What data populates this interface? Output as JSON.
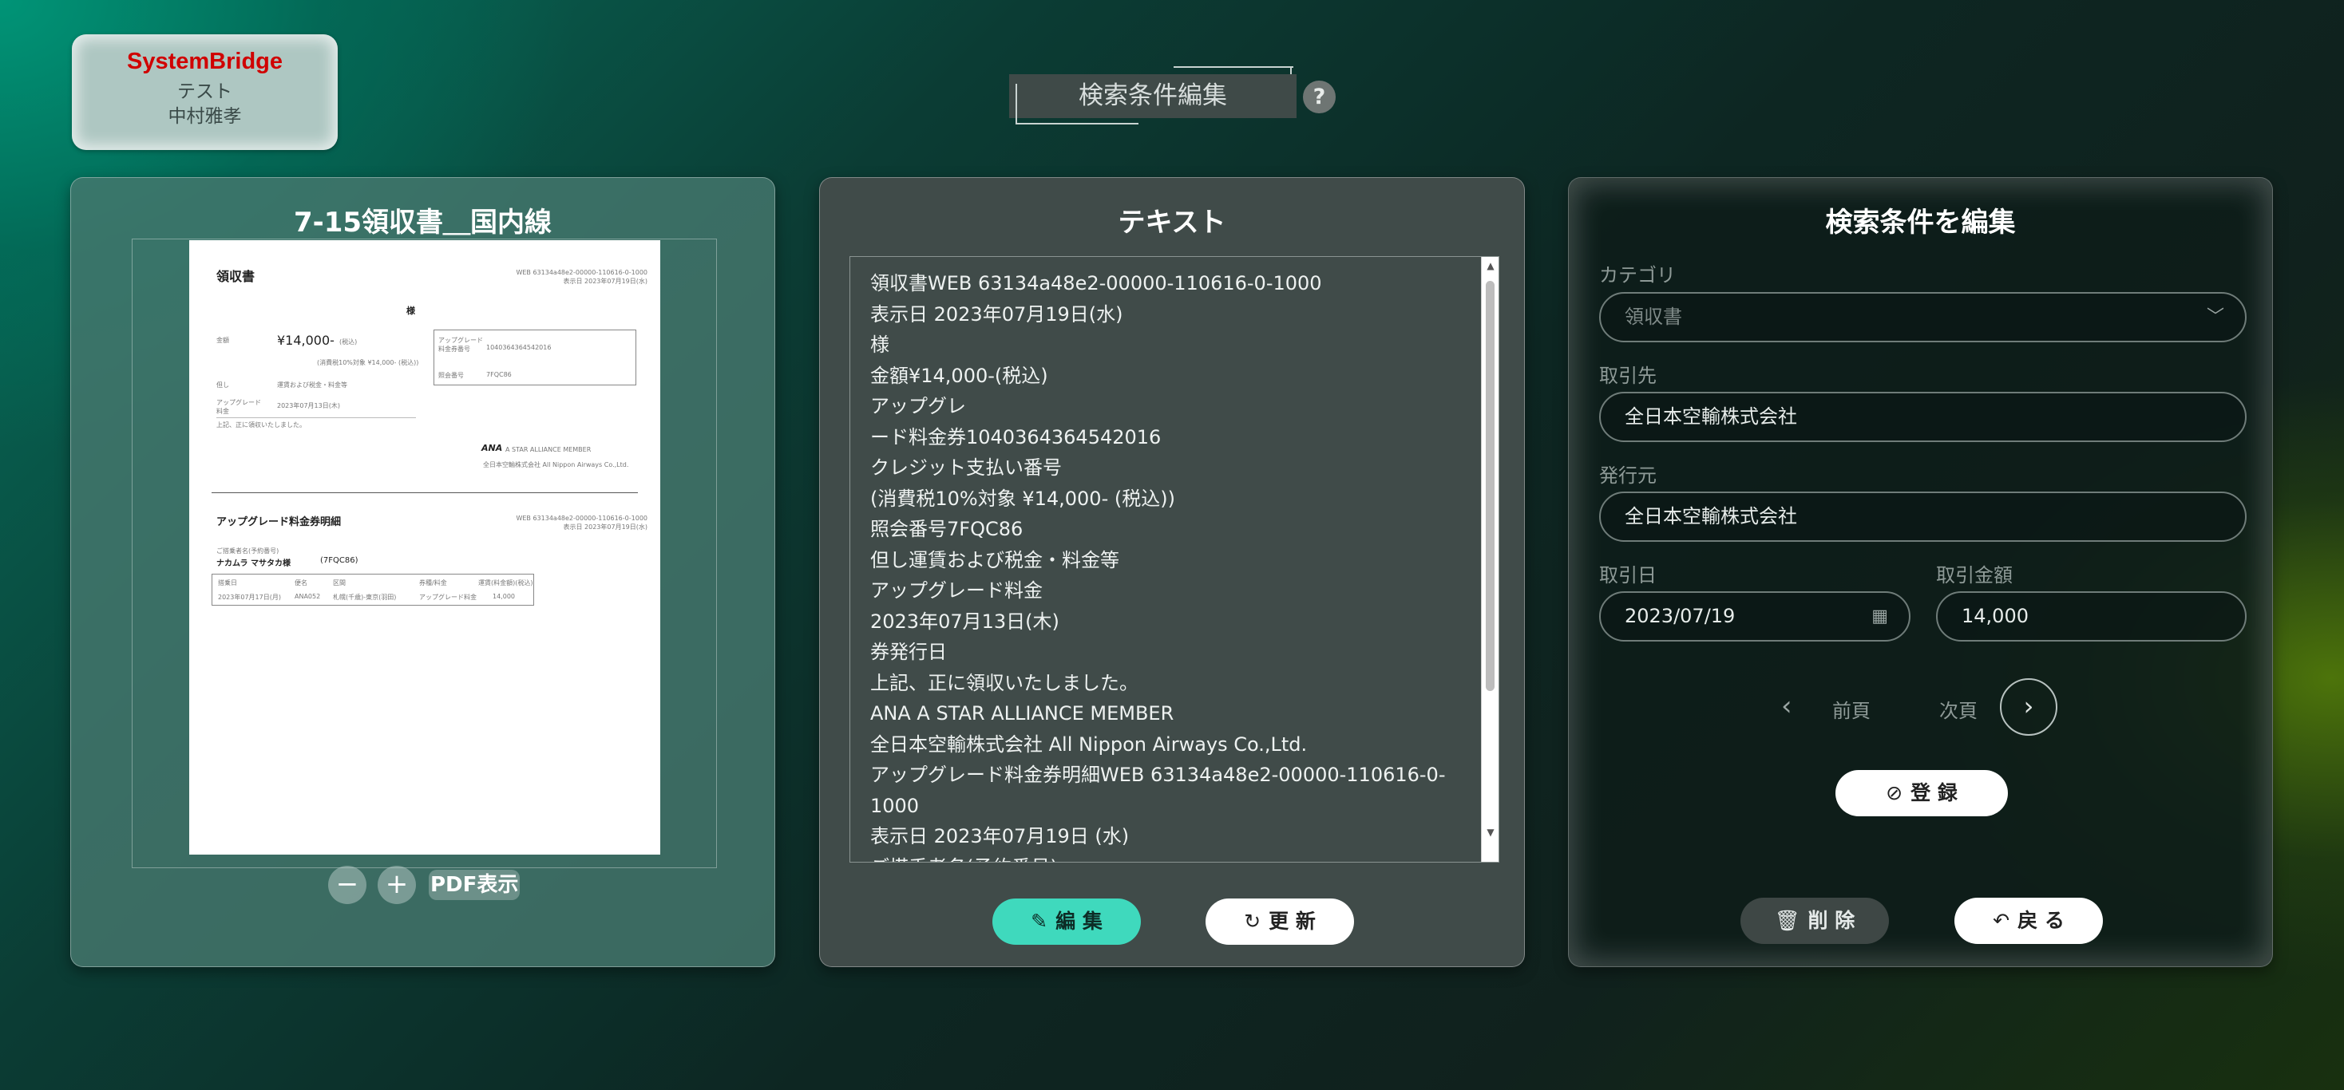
{
  "logo": {
    "brand": "SystemBridge",
    "line1": "テスト",
    "line2": "中村雅孝"
  },
  "header": {
    "title": "検索条件編集",
    "help": "?"
  },
  "preview": {
    "title": "7-15領収書＿国内線",
    "zoom_out": "−",
    "zoom_in": "+",
    "pdf_label": "PDF表示",
    "doc": {
      "heading": "領収書",
      "header_right1": "WEB 63134a48e2-00000-110616-0-1000",
      "header_right2": "表示日 2023年07月19日(水)",
      "sama": "様",
      "amount_label": "金額",
      "amount": "¥14,000-",
      "amount_suffix": "(税込)",
      "amount_note": "(消費税10%対象 ¥14,000- (税込))",
      "tadashi": "但し",
      "tadashi_val": "運賃および税金・料金等",
      "upgrade_label": "アップグレード料金",
      "upgrade_date": "2023年07月13日(木)",
      "receipt_note": "上記、正に領収いたしました。",
      "right_box_label1": "アップグレード料金券番号",
      "right_box_val1": "1040364364542016",
      "right_box_label2": "照会番号",
      "right_box_val2": "7FQC86",
      "ana_logo": "ANA",
      "ana_star": "A STAR ALLIANCE MEMBER",
      "ana_company": "全日本空輸株式会社 All Nippon Airways Co.,Ltd.",
      "detail_heading": "アップグレード料金券明細",
      "detail_right1": "WEB 63134a48e2-00000-110616-0-1000",
      "detail_right2": "表示日 2023年07月19日(水)",
      "passenger_label": "ご搭乗者名(予約番号)",
      "passenger": "ナカムラ マサタカ様",
      "booking": "(7FQC86)",
      "col1": "搭乗日",
      "col2": "便名",
      "col3": "区間",
      "col4": "券種/料金",
      "col5": "運賃(料金額)(税込)",
      "row1": "2023年07月17日(月)",
      "row2": "ANA052",
      "row3": "札幌(千歳)-東京(羽田)",
      "row4": "アップグレード料金",
      "row5": "14,000"
    }
  },
  "text_panel": {
    "title": "テキスト",
    "lines": [
      "領収書WEB 63134a48e2-00000-110616-0-1000",
      "表示日 2023年07月19日(水)",
      "様",
      "金額¥14,000-(税込)",
      "アップグレ",
      "ード料金券1040364364542016",
      "クレジット支払い番号",
      "(消費税10%対象 ¥14,000- (税込))",
      "照会番号7FQC86",
      "但し運賃および税金・料金等",
      "アップグレード料金",
      "2023年07月13日(木)",
      "券発行日",
      "上記、正に領収いたしました。",
      "ANA A STAR ALLIANCE MEMBER",
      "全日本空輸株式会社 All Nippon Airways Co.,Ltd.",
      "アップグレード料金券明細WEB 63134a48e2-00000-110616-0-",
      "1000",
      "表示日 2023年07月19日 (水)",
      "ご搭乗者名(予約番号)"
    ],
    "edit_label": "編 集",
    "update_label": "更 新"
  },
  "form": {
    "title": "検索条件を編集",
    "category_label": "カテゴリ",
    "category_value": "領収書",
    "partner_label": "取引先",
    "partner_value": "全日本空輸株式会社",
    "issuer_label": "発行元",
    "issuer_value": "全日本空輸株式会社",
    "date_label": "取引日",
    "date_value": "2023/07/19",
    "amount_label": "取引金額",
    "amount_value": "14,000",
    "prev_label": "前頁",
    "next_label": "次頁",
    "register_label": "登 録",
    "delete_label": "削 除",
    "back_label": "戻 る"
  },
  "colors": {
    "edit_button": "#3fd9bd",
    "brand_red": "#d00000"
  }
}
